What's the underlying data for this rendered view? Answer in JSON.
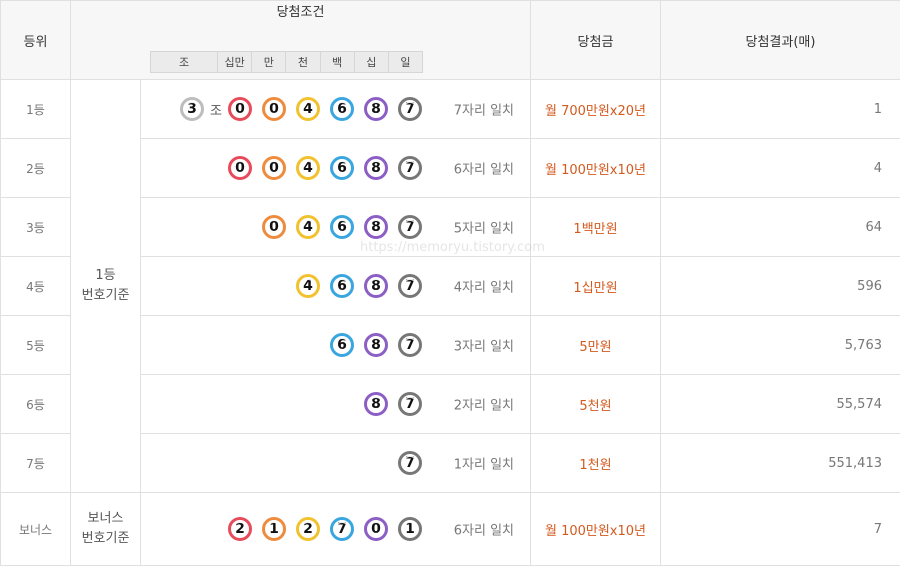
{
  "header": {
    "rank": "등위",
    "condition": "당첨조건",
    "prize": "당첨금",
    "result": "당첨결과(매)",
    "digits": [
      "조",
      "십만",
      "만",
      "천",
      "백",
      "십",
      "일"
    ]
  },
  "basis": {
    "main": [
      "1등",
      "번호기준"
    ],
    "bonus": [
      "보너스",
      "번호기준"
    ]
  },
  "jo_label": "조",
  "watermark": "https://memoryu.tistory.com",
  "rows": [
    {
      "rank": "1등",
      "balls": [
        [
          "3",
          "white"
        ],
        [
          "0",
          "red"
        ],
        [
          "0",
          "orange"
        ],
        [
          "4",
          "yellow"
        ],
        [
          "6",
          "blue"
        ],
        [
          "8",
          "purple"
        ],
        [
          "7",
          "gray"
        ]
      ],
      "match": "7자리 일치",
      "prize": "월 700만원x20년",
      "count": "1"
    },
    {
      "rank": "2등",
      "balls": [
        [
          "0",
          "red"
        ],
        [
          "0",
          "orange"
        ],
        [
          "4",
          "yellow"
        ],
        [
          "6",
          "blue"
        ],
        [
          "8",
          "purple"
        ],
        [
          "7",
          "gray"
        ]
      ],
      "match": "6자리 일치",
      "prize": "월 100만원x10년",
      "count": "4"
    },
    {
      "rank": "3등",
      "balls": [
        [
          "0",
          "orange"
        ],
        [
          "4",
          "yellow"
        ],
        [
          "6",
          "blue"
        ],
        [
          "8",
          "purple"
        ],
        [
          "7",
          "gray"
        ]
      ],
      "match": "5자리 일치",
      "prize": "1백만원",
      "count": "64"
    },
    {
      "rank": "4등",
      "balls": [
        [
          "4",
          "yellow"
        ],
        [
          "6",
          "blue"
        ],
        [
          "8",
          "purple"
        ],
        [
          "7",
          "gray"
        ]
      ],
      "match": "4자리 일치",
      "prize": "1십만원",
      "count": "596"
    },
    {
      "rank": "5등",
      "balls": [
        [
          "6",
          "blue"
        ],
        [
          "8",
          "purple"
        ],
        [
          "7",
          "gray"
        ]
      ],
      "match": "3자리 일치",
      "prize": "5만원",
      "count": "5,763"
    },
    {
      "rank": "6등",
      "balls": [
        [
          "8",
          "purple"
        ],
        [
          "7",
          "gray"
        ]
      ],
      "match": "2자리 일치",
      "prize": "5천원",
      "count": "55,574"
    },
    {
      "rank": "7등",
      "balls": [
        [
          "7",
          "gray"
        ]
      ],
      "match": "1자리 일치",
      "prize": "1천원",
      "count": "551,413"
    },
    {
      "rank": "보너스",
      "balls": [
        [
          "2",
          "red"
        ],
        [
          "1",
          "orange"
        ],
        [
          "2",
          "yellow"
        ],
        [
          "7",
          "blue"
        ],
        [
          "0",
          "purple"
        ],
        [
          "1",
          "gray"
        ]
      ],
      "match": "6자리 일치",
      "prize": "월 100만원x10년",
      "count": "7"
    }
  ]
}
